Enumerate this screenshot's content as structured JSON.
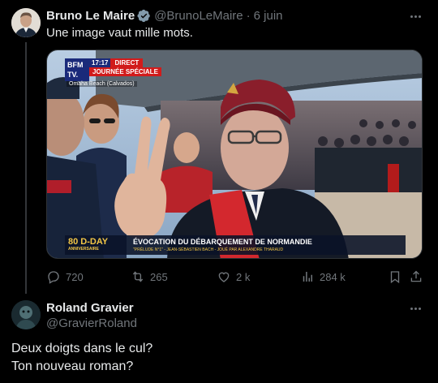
{
  "tweet": {
    "author_name": "Bruno Le Maire",
    "handle": "@BrunoLeMaire",
    "separator": "·",
    "date": "6 juin",
    "text": "Une image vaut mille mots.",
    "media": {
      "channel_logo": "BFM TV.",
      "time": "17:17",
      "live_label": "DIRECT",
      "banner": "JOURNÉE SPÉCIALE",
      "location": "Omaha Beach (Calvados)",
      "ticker_logo": "80 D-DAY",
      "ticker_logo_sub": "ANNIVERSAIRE",
      "ticker_title": "ÉVOCATION DU DÉBARQUEMENT DE NORMANDIE",
      "ticker_subtitle": "\"PRÉLUDE N°1\" - JEAN-SÉBASTIEN BACH - JOUÉ PAR ALEXANDRE THARAUD"
    },
    "stats": {
      "replies": "720",
      "reposts": "265",
      "likes": "2 k",
      "views": "284 k"
    }
  },
  "reply": {
    "author_name": "Roland Gravier",
    "handle": "@GravierRoland",
    "text_line1": "Deux doigts dans le cul?",
    "text_line2": "Ton nouveau roman?"
  },
  "icons": [
    "verified-icon",
    "more-icon",
    "reply-icon",
    "repost-icon",
    "like-icon",
    "views-icon",
    "bookmark-icon",
    "share-icon"
  ],
  "colors": {
    "background": "#000000",
    "text": "#e7e9ea",
    "muted": "#71767b",
    "verified": "#829aab",
    "divider": "#2f3336"
  }
}
